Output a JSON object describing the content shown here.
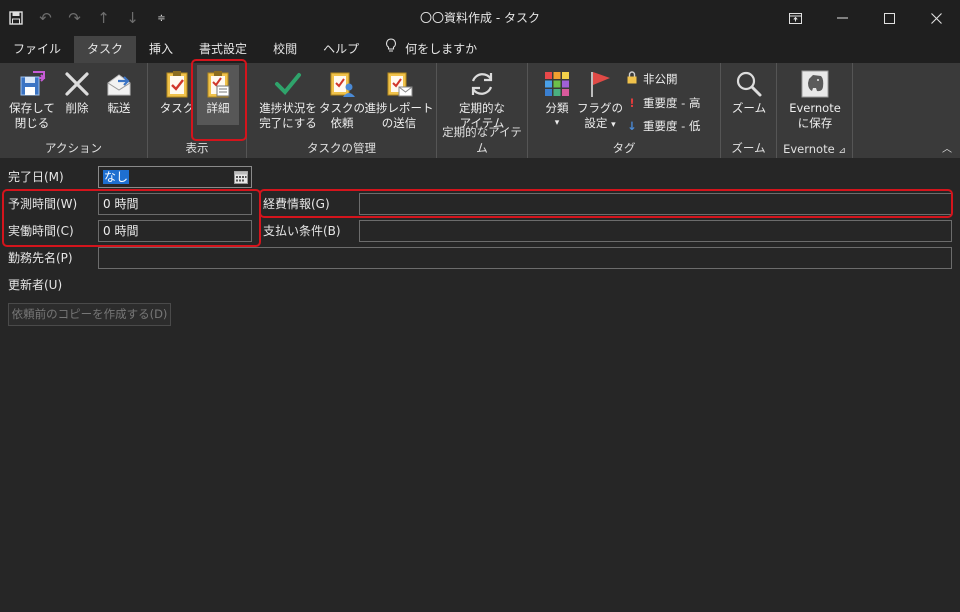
{
  "window": {
    "title": "〇〇資料作成 - タスク"
  },
  "qat_icons": [
    "save-icon",
    "undo-icon",
    "redo-icon",
    "up-arrow-icon",
    "down-arrow-icon",
    "customize-icon"
  ],
  "menu": {
    "tabs": [
      "ファイル",
      "タスク",
      "挿入",
      "書式設定",
      "校閲",
      "ヘルプ"
    ],
    "active_tab": "タスク",
    "tell_me": "何をしますか"
  },
  "ribbon": {
    "actions": {
      "label": "アクション",
      "save_close": [
        "保存して",
        "閉じる"
      ],
      "delete": "削除",
      "forward": "転送"
    },
    "show": {
      "label": "表示",
      "task": "タスク",
      "details": "詳細"
    },
    "manage": {
      "label": "タスクの管理",
      "mark_complete": [
        "進捗状況を",
        "完了にする"
      ],
      "assign": [
        "タスクの",
        "依頼"
      ],
      "send_report": [
        "進捗レポート",
        "の送信"
      ]
    },
    "recurrence": {
      "label": "定期的なアイテム",
      "button": [
        "定期的な",
        "アイテム"
      ]
    },
    "tags": {
      "label": "タグ",
      "categorize": "分類",
      "follow_up": [
        "フラグの",
        "設定"
      ],
      "private": "非公開",
      "high": "重要度 - 高",
      "low": "重要度 - 低"
    },
    "zoom": {
      "label": "ズーム",
      "button": "ズーム"
    },
    "evernote": {
      "label": "Evernote",
      "button": [
        "Evernote",
        "に保存"
      ]
    }
  },
  "form": {
    "date_completed_label": "完了日(M)",
    "date_completed_value": "なし",
    "total_work_label": "予測時間(W)",
    "total_work_value": "0 時間",
    "actual_work_label": "実働時間(C)",
    "actual_work_value": "0 時間",
    "mileage_label": "経費情報(G)",
    "mileage_value": "",
    "billing_label": "支払い条件(B)",
    "billing_value": "",
    "company_label": "勤務先名(P)",
    "company_value": "",
    "update_list_label": "更新者(U)",
    "copy_button": "依頼前のコピーを作成する(D)"
  },
  "colors": {
    "highlight": "#d4141c",
    "background": "#262626",
    "ribbon": "#3a3a3a",
    "titlebar": "#1f1f1f"
  }
}
